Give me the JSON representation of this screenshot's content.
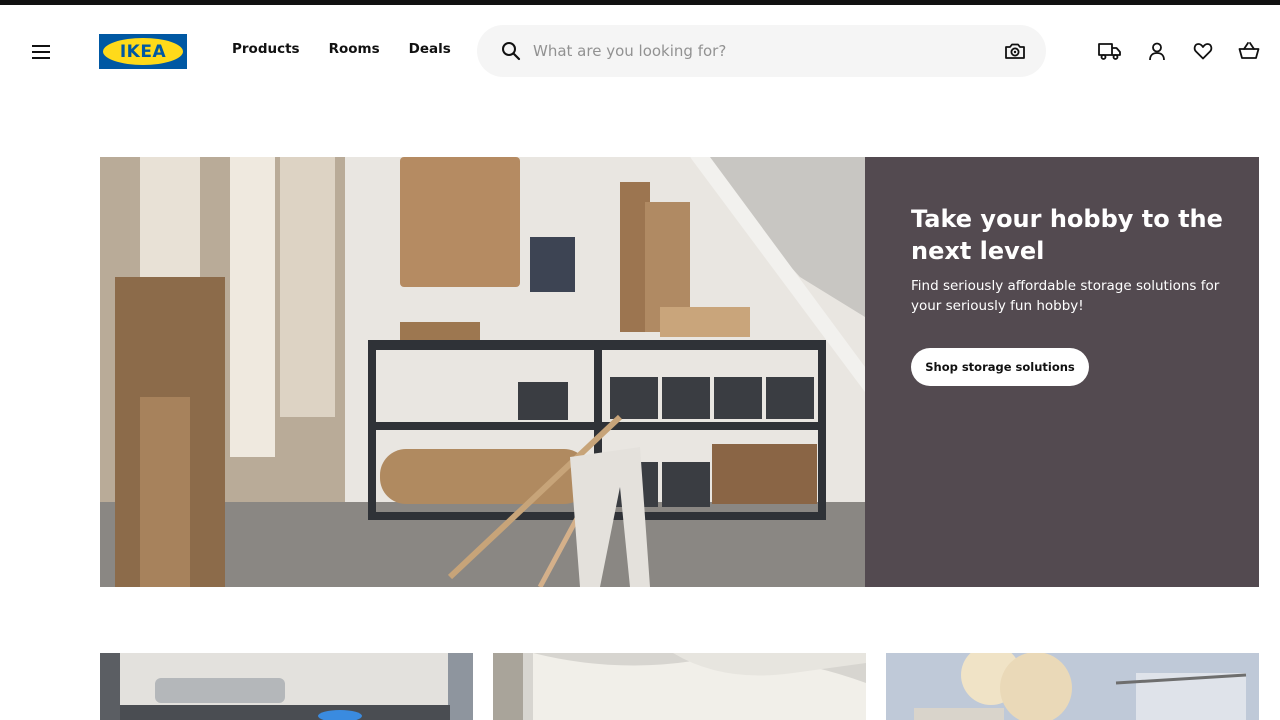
{
  "header": {
    "logo_text": "IKEA",
    "nav": [
      "Products",
      "Rooms",
      "Deals"
    ],
    "search": {
      "placeholder": "What are you looking for?"
    },
    "icons": [
      "menu-icon",
      "search-icon",
      "camera-icon",
      "truck-icon",
      "user-icon",
      "heart-icon",
      "basket-icon"
    ]
  },
  "hero": {
    "title": "Take your hobby to the next level",
    "subtitle": "Find seriously affordable storage solutions for your seriously fun hobby!",
    "cta": "Shop storage solutions",
    "panel_color": "#534a50"
  },
  "colors": {
    "brand_blue": "#0058a3",
    "brand_yellow": "#ffda1a",
    "search_bg": "#f5f5f5"
  }
}
